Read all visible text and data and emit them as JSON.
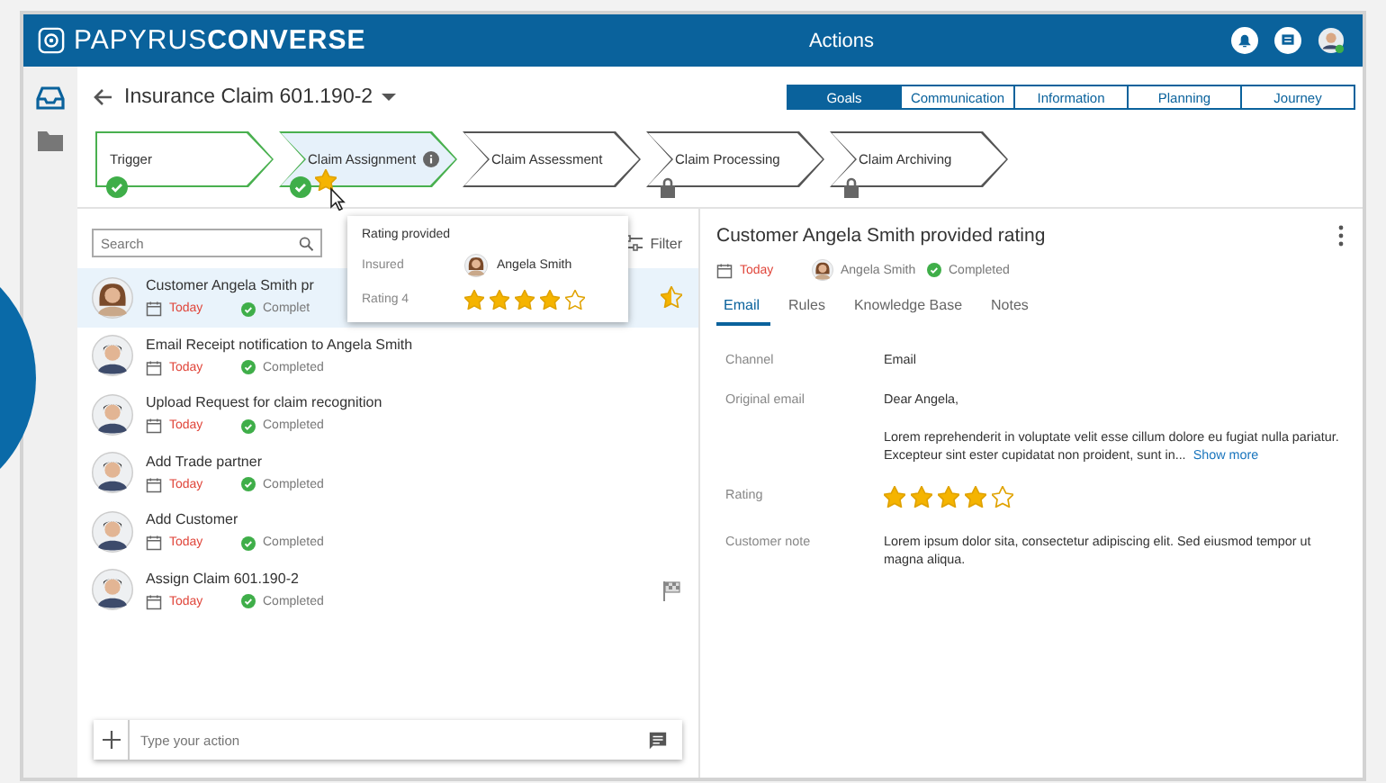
{
  "header": {
    "logo": "PAPYRUS**CONVERSE**",
    "title": "Actions"
  },
  "case": {
    "title": "Insurance Claim 601.190-2"
  },
  "views": [
    {
      "label": "Goals",
      "selected": true
    },
    {
      "label": "Communication",
      "selected": false
    },
    {
      "label": "Information",
      "selected": false
    },
    {
      "label": "Planning",
      "selected": false
    },
    {
      "label": "Journey",
      "selected": false
    }
  ],
  "steps": [
    {
      "label": "Trigger",
      "kind": "done",
      "selected": false,
      "info": false,
      "rated": false
    },
    {
      "label": "Claim Assignment",
      "kind": "done",
      "selected": true,
      "info": true,
      "rated": true
    },
    {
      "label": "Claim Assessment",
      "kind": "open",
      "selected": false,
      "info": false,
      "rated": false
    },
    {
      "label": "Claim Processing",
      "kind": "locked",
      "selected": false,
      "info": false,
      "rated": false
    },
    {
      "label": "Claim Archiving",
      "kind": "locked",
      "selected": false,
      "info": false,
      "rated": false
    }
  ],
  "search": {
    "placeholder": "Search"
  },
  "filter": {
    "label": "Filter"
  },
  "popover": {
    "title": "Rating provided",
    "insured_label": "Insured",
    "insured_name": "Angela Smith",
    "rating_label": "Rating 4",
    "stars": 4
  },
  "actions": [
    {
      "title": "Customer Angela Smith pr",
      "date": "Today",
      "status": "Complet",
      "selected": true,
      "kind": "woman",
      "starred": true,
      "flagged": false
    },
    {
      "title": "Email Receipt notification to Angela Smith",
      "date": "Today",
      "status": "Completed",
      "selected": false,
      "kind": "man",
      "starred": false,
      "flagged": false
    },
    {
      "title": "Upload Request for claim recognition",
      "date": "Today",
      "status": "Completed",
      "selected": false,
      "kind": "man",
      "starred": false,
      "flagged": false
    },
    {
      "title": "Add Trade partner",
      "date": "Today",
      "status": "Completed",
      "selected": false,
      "kind": "man",
      "starred": false,
      "flagged": false
    },
    {
      "title": "Add Customer",
      "date": "Today",
      "status": "Completed",
      "selected": false,
      "kind": "man",
      "starred": false,
      "flagged": false
    },
    {
      "title": "Assign Claim 601.190-2",
      "date": "Today",
      "status": "Completed",
      "selected": false,
      "kind": "man",
      "starred": false,
      "flagged": true
    }
  ],
  "composer": {
    "placeholder": "Type your action"
  },
  "detail": {
    "title": "Customer Angela Smith provided rating",
    "date": "Today",
    "person": "Angela Smith",
    "status": "Completed",
    "tabs": [
      {
        "label": "Email",
        "selected": true
      },
      {
        "label": "Rules",
        "selected": false
      },
      {
        "label": "Knowledge Base",
        "selected": false
      },
      {
        "label": "Notes",
        "selected": false
      }
    ],
    "fields": [
      {
        "kind": "text",
        "label": "Channel",
        "value": "Email"
      },
      {
        "kind": "email",
        "label": "Original email",
        "greeting": "Dear Angela,",
        "body": "Lorem reprehenderit in voluptate velit esse cillum dolore eu fugiat nulla pariatur. Excepteur sint ester cupidatat non proident, sunt in...",
        "link": "Show more"
      },
      {
        "kind": "stars",
        "label": "Rating",
        "stars": 4
      },
      {
        "kind": "text",
        "label": "Customer note",
        "value": "Lorem ipsum dolor sita, consectetur adipiscing elit. Sed eiusmod tempor ut magna aliqua."
      }
    ]
  }
}
